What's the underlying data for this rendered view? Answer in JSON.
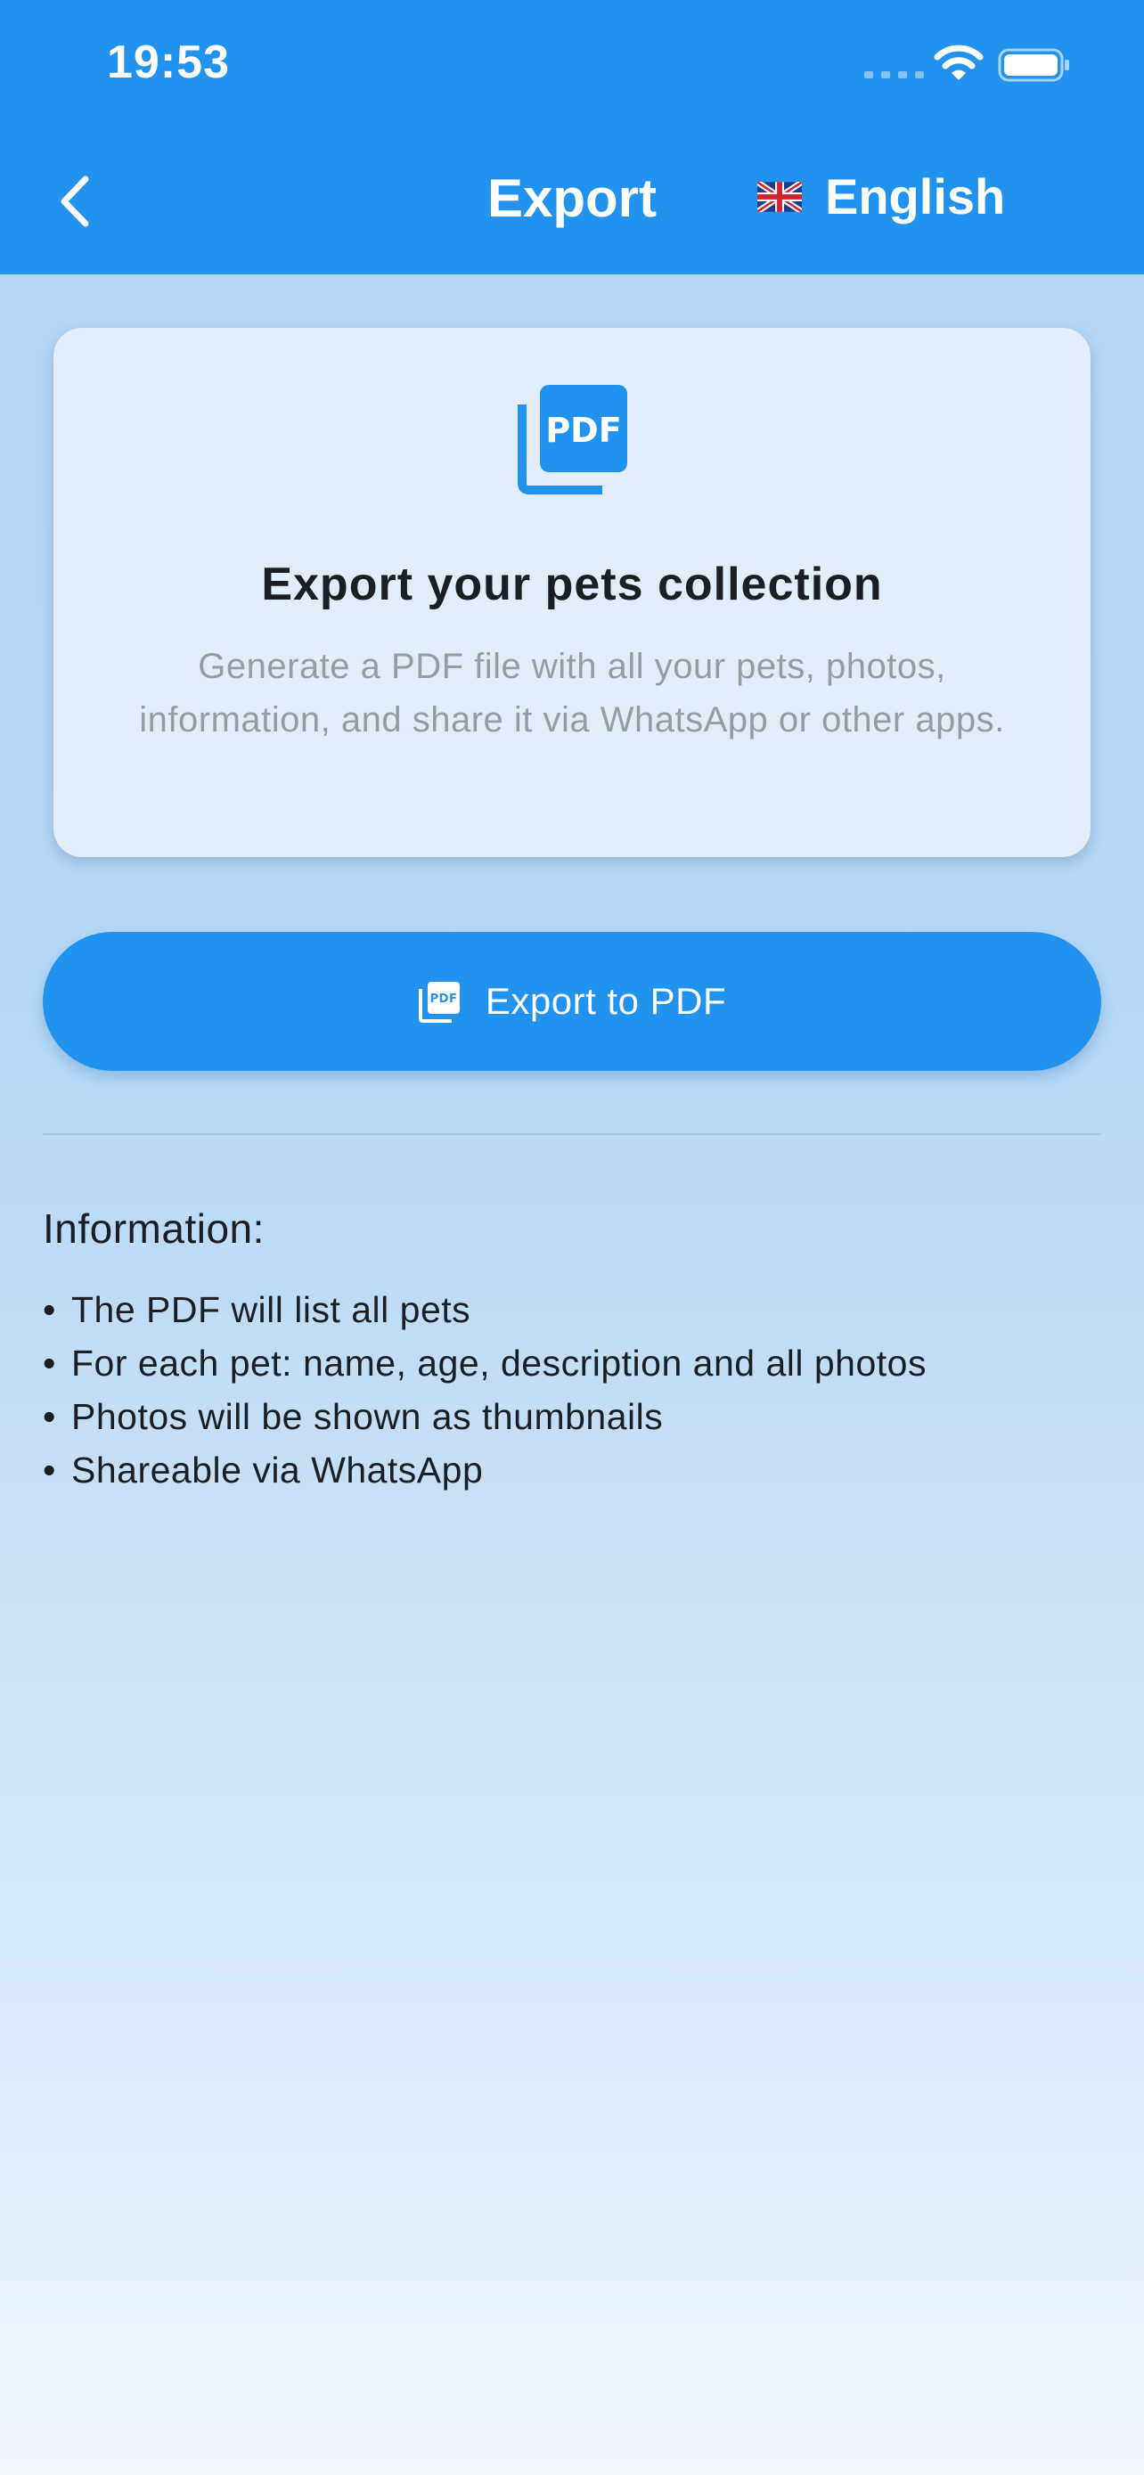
{
  "status_bar": {
    "time": "19:53"
  },
  "header": {
    "title": "Export",
    "back_icon": "chevron-left-icon",
    "language": {
      "flag": "uk-flag-icon",
      "label": "English"
    }
  },
  "card": {
    "icon": "pdf-icon",
    "title": "Export your pets collection",
    "description": "Generate a PDF file with all your pets, photos, information, and share it via WhatsApp or other apps."
  },
  "export_button": {
    "icon": "pdf-icon",
    "label": "Export to PDF"
  },
  "information": {
    "heading": "Information:",
    "items": [
      "The PDF will list all pets",
      "For each pet: name, age, description and all photos",
      "Photos will be shown as thumbnails",
      "Shareable via WhatsApp"
    ]
  },
  "colors": {
    "primary": "#2193ee",
    "card_background": "#e3edf9",
    "text_dark": "#1b1f24",
    "text_muted": "#979ca3"
  }
}
